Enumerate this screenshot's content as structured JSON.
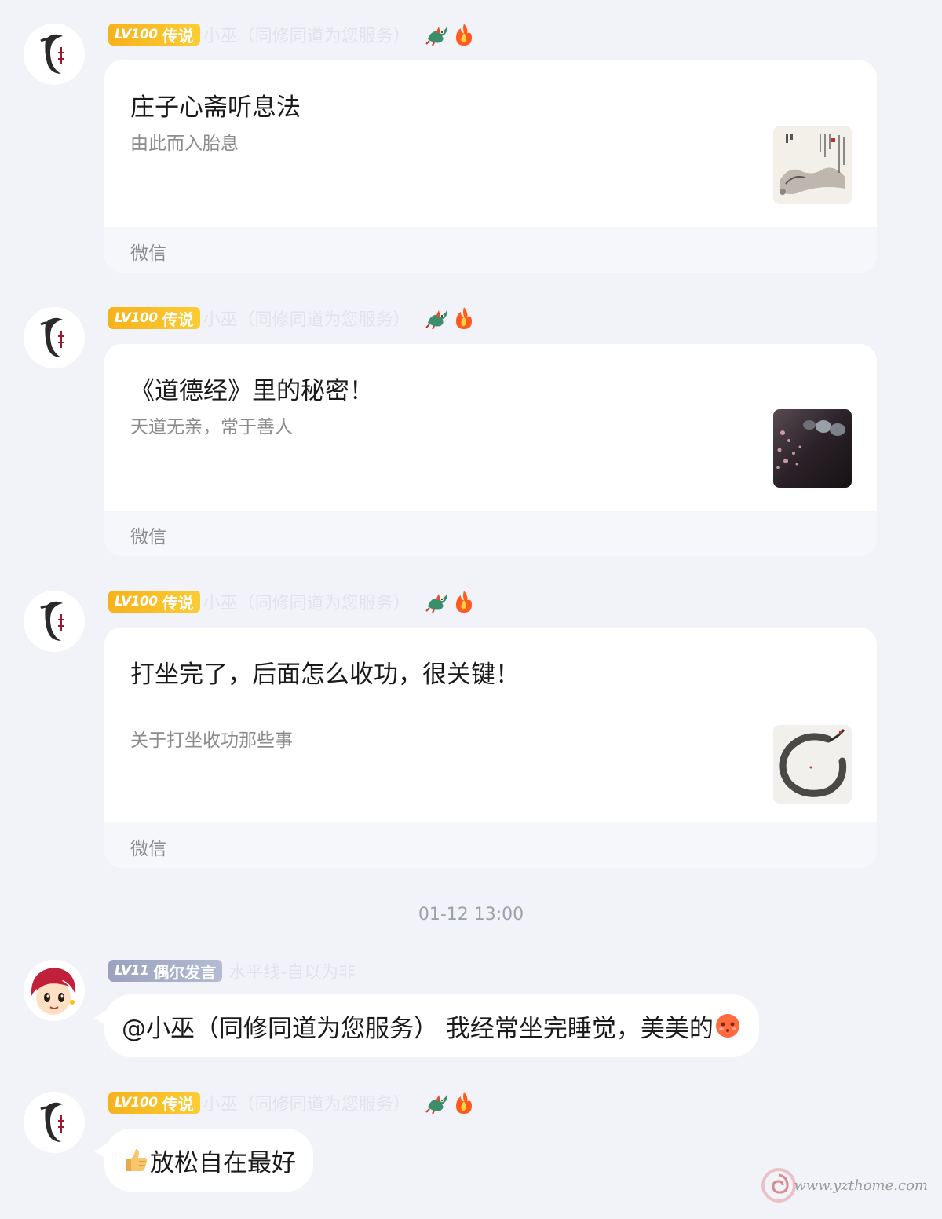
{
  "messages": [
    {
      "user": {
        "level": "LV100",
        "title": "传说",
        "nickname": "小巫（同修同道为您服务）"
      },
      "card": {
        "title": "庄子心斋听息法",
        "desc": "由此而入胎息",
        "source": "微信"
      }
    },
    {
      "user": {
        "level": "LV100",
        "title": "传说",
        "nickname": "小巫（同修同道为您服务）"
      },
      "card": {
        "title": "《道德经》里的秘密！",
        "desc": "天道无亲，常于善人",
        "source": "微信"
      }
    },
    {
      "user": {
        "level": "LV100",
        "title": "传说",
        "nickname": "小巫（同修同道为您服务）"
      },
      "card": {
        "title": "打坐完了，后面怎么收功，很关键！",
        "desc": "关于打坐收功那些事",
        "source": "微信"
      }
    }
  ],
  "timestamp": "01-12 13:00",
  "reply1": {
    "user": {
      "level": "LV11",
      "title": "偶尔发言",
      "nickname": "水平线-自以为非"
    },
    "text": "@小巫（同修同道为您服务） 我经常坐完睡觉，美美的",
    "emoji": "blushing-face-icon"
  },
  "reply2": {
    "user": {
      "level": "LV100",
      "title": "传说",
      "nickname": "小巫（同修同道为您服务）"
    },
    "emoji": "thumbs-up-icon",
    "text": "放松自在最好"
  },
  "watermark": "www.yzthome.com",
  "colors": {
    "gold_badge": "#f8b51f",
    "gray_badge": "#a4abc5",
    "background": "#f2f3f8"
  }
}
